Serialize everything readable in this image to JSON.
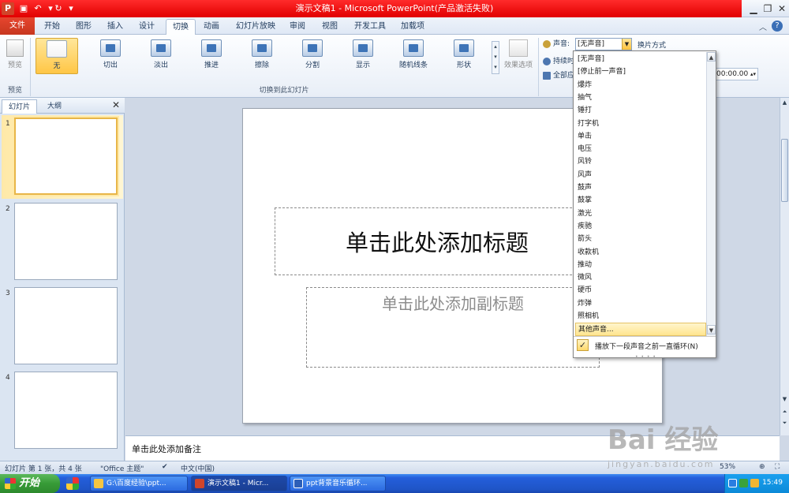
{
  "window": {
    "title": "演示文稿1 - Microsoft PowerPoint(产品激活失败)",
    "min_icon": "minimize-icon",
    "max_icon": "restore-icon",
    "close_icon": "close-icon"
  },
  "ribbon_tabs": [
    "文件",
    "开始",
    "图形",
    "插入",
    "设计",
    "切换",
    "动画",
    "幻灯片放映",
    "审阅",
    "视图",
    "开发工具",
    "加载项"
  ],
  "ribbon": {
    "preview_label": "预览",
    "preview_group": "预览",
    "transitions": [
      "无",
      "切出",
      "淡出",
      "推进",
      "擦除",
      "分割",
      "显示",
      "随机线条",
      "形状"
    ],
    "effect_options": "效果选项",
    "transition_group": "切换到此幻灯片",
    "sound_label": "声音:",
    "sound_value": "[无声音]",
    "switch_mode_label": "换片方式",
    "duration_label": "持续时",
    "apply_all_label": "全部应",
    "time_value": "00:00.00"
  },
  "left_pane": {
    "tabs": [
      "幻灯片",
      "大纲"
    ],
    "close": "✕",
    "slide_numbers": [
      "1",
      "2",
      "3",
      "4"
    ]
  },
  "slide": {
    "title_placeholder": "单击此处添加标题",
    "subtitle_placeholder": "单击此处添加副标题"
  },
  "notes": {
    "placeholder": "单击此处添加备注"
  },
  "status": {
    "slide_info": "幻灯片 第 1 张，共 4 张",
    "theme": "\"Office 主题\"",
    "language": "中文(中国)",
    "zoom": "53%"
  },
  "dropdown": {
    "items": [
      "[无声音]",
      "[停止前一声音]",
      "爆炸",
      "抽气",
      "锤打",
      "打字机",
      "单击",
      "电压",
      "风铃",
      "风声",
      "鼓声",
      "鼓掌",
      "激光",
      "疾驰",
      "箭头",
      "收款机",
      "推动",
      "微风",
      "硬币",
      "炸弹",
      "照相机",
      "其他声音..."
    ],
    "highlighted": "其他声音...",
    "loop_label": "播放下一段声音之前一直循环(N)",
    "loop_checked": true
  },
  "taskbar": {
    "start": "开始",
    "tasks": [
      "G:\\百度经验\\ppt...",
      "演示文稿1 - Micr...",
      "ppt背景音乐循环..."
    ],
    "clock": "15:49"
  },
  "watermark": {
    "brand": "Bai 经验",
    "url": "jingyan.baidu.com"
  },
  "colors": {
    "title_bar_red": "#e10000",
    "ribbon_accent": "#ffc646",
    "taskbar_blue": "#245edb",
    "start_green": "#379b37"
  }
}
